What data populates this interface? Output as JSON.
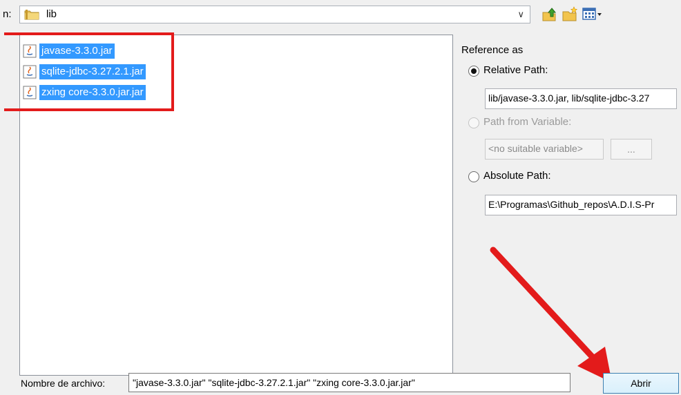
{
  "lookin": {
    "label": "n:",
    "folder": "lib",
    "dropdown_icon": "chevron-down-icon"
  },
  "toolbar": {
    "icons": [
      "up-folder-icon",
      "new-folder-icon",
      "view-menu-icon"
    ]
  },
  "files": [
    {
      "name": "javase-3.3.0.jar",
      "icon": "jar-icon",
      "selected": true
    },
    {
      "name": "sqlite-jdbc-3.27.2.1.jar",
      "icon": "jar-icon",
      "selected": true
    },
    {
      "name": "zxing core-3.3.0.jar.jar",
      "icon": "jar-icon",
      "selected": true
    }
  ],
  "reference": {
    "title": "Reference as",
    "relative": {
      "label": "Relative Path:",
      "checked": true,
      "value": "lib/javase-3.3.0.jar, lib/sqlite-jdbc-3.27"
    },
    "variable": {
      "label": "Path from Variable:",
      "enabled": false,
      "value": "<no suitable variable>",
      "browse_label": "..."
    },
    "absolute": {
      "label": "Absolute Path:",
      "checked": false,
      "value": "E:\\Programas\\Github_repos\\A.D.I.S-Pr"
    }
  },
  "filename": {
    "label": "Nombre de archivo:",
    "value": "\"javase-3.3.0.jar\" \"sqlite-jdbc-3.27.2.1.jar\" \"zxing core-3.3.0.jar.jar\""
  },
  "actions": {
    "open_label": "Abrir"
  },
  "colors": {
    "selection": "#3399ff",
    "annotation": "#e31b1b"
  }
}
